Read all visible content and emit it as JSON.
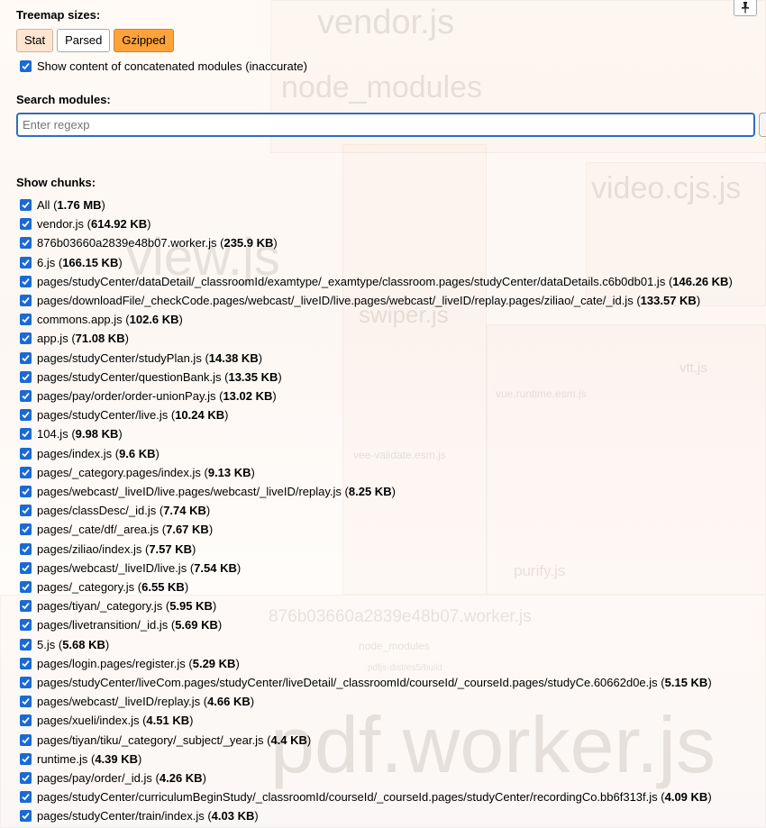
{
  "background_labels": [
    {
      "text": "vendor.js"
    },
    {
      "text": "node_modules"
    },
    {
      "text": "video.cjs.js"
    },
    {
      "text": "view.js"
    },
    {
      "text": "swiper.js"
    },
    {
      "text": "vue.runtime.esm.js"
    },
    {
      "text": "vee-validate.esm.js"
    },
    {
      "text": "vtt.js"
    },
    {
      "text": "purify.js"
    },
    {
      "text": "876b03660a2839e48b07.worker.js"
    },
    {
      "text": "node_modules"
    },
    {
      "text": "pdfjs-dist/es5/build"
    },
    {
      "text": "pdf.worker.js"
    }
  ],
  "treemap_sizes": {
    "title": "Treemap sizes:",
    "options": [
      "Stat",
      "Parsed",
      "Gzipped"
    ],
    "selected": "Gzipped"
  },
  "show_content": {
    "checked": true,
    "label": "Show content of concatenated modules (inaccurate)"
  },
  "search": {
    "title": "Search modules:",
    "placeholder": "Enter regexp",
    "value": ""
  },
  "chunks": {
    "title": "Show chunks:",
    "items": [
      {
        "name": "All",
        "size": "1.76 MB"
      },
      {
        "name": "vendor.js",
        "size": "614.92 KB"
      },
      {
        "name": "876b03660a2839e48b07.worker.js",
        "size": "235.9 KB"
      },
      {
        "name": "6.js",
        "size": "166.15 KB"
      },
      {
        "name": "pages/studyCenter/dataDetail/_classroomId/examtype/_examtype/classroom.pages/studyCenter/dataDetails.c6b0db01.js",
        "size": "146.26 KB"
      },
      {
        "name": "pages/downloadFile/_checkCode.pages/webcast/_liveID/live.pages/webcast/_liveID/replay.pages/ziliao/_cate/_id.js",
        "size": "133.57 KB"
      },
      {
        "name": "commons.app.js",
        "size": "102.6 KB"
      },
      {
        "name": "app.js",
        "size": "71.08 KB"
      },
      {
        "name": "pages/studyCenter/studyPlan.js",
        "size": "14.38 KB"
      },
      {
        "name": "pages/studyCenter/questionBank.js",
        "size": "13.35 KB"
      },
      {
        "name": "pages/pay/order/order-unionPay.js",
        "size": "13.02 KB"
      },
      {
        "name": "pages/studyCenter/live.js",
        "size": "10.24 KB"
      },
      {
        "name": "104.js",
        "size": "9.98 KB"
      },
      {
        "name": "pages/index.js",
        "size": "9.6 KB"
      },
      {
        "name": "pages/_category.pages/index.js",
        "size": "9.13 KB"
      },
      {
        "name": "pages/webcast/_liveID/live.pages/webcast/_liveID/replay.js",
        "size": "8.25 KB"
      },
      {
        "name": "pages/classDesc/_id.js",
        "size": "7.74 KB"
      },
      {
        "name": "pages/_cate/df/_area.js",
        "size": "7.67 KB"
      },
      {
        "name": "pages/ziliao/index.js",
        "size": "7.57 KB"
      },
      {
        "name": "pages/webcast/_liveID/live.js",
        "size": "7.54 KB"
      },
      {
        "name": "pages/_category.js",
        "size": "6.55 KB"
      },
      {
        "name": "pages/tiyan/_category.js",
        "size": "5.95 KB"
      },
      {
        "name": "pages/livetransition/_id.js",
        "size": "5.69 KB"
      },
      {
        "name": "5.js",
        "size": "5.68 KB"
      },
      {
        "name": "pages/login.pages/register.js",
        "size": "5.29 KB"
      },
      {
        "name": "pages/studyCenter/liveCom.pages/studyCenter/liveDetail/_classroomId/courseId/_courseId.pages/studyCe.60662d0e.js",
        "size": "5.15 KB"
      },
      {
        "name": "pages/webcast/_liveID/replay.js",
        "size": "4.66 KB"
      },
      {
        "name": "pages/xueli/index.js",
        "size": "4.51 KB"
      },
      {
        "name": "pages/tiyan/tiku/_category/_subject/_year.js",
        "size": "4.4 KB"
      },
      {
        "name": "runtime.js",
        "size": "4.39 KB"
      },
      {
        "name": "pages/pay/order/_id.js",
        "size": "4.26 KB"
      },
      {
        "name": "pages/studyCenter/curriculumBeginStudy/_classroomId/courseId/_courseId.pages/studyCenter/recordingCo.bb6f313f.js",
        "size": "4.09 KB"
      },
      {
        "name": "pages/studyCenter/train/index.js",
        "size": "4.03 KB"
      }
    ]
  },
  "icons": {
    "pin": "pin-icon",
    "checkbox": "checkbox-checked-icon"
  },
  "colors": {
    "active_button": "#ffa23a",
    "stat_button": "#fde5cf",
    "checkbox": "#1a6ad6",
    "search_border": "#2d6fbe"
  }
}
